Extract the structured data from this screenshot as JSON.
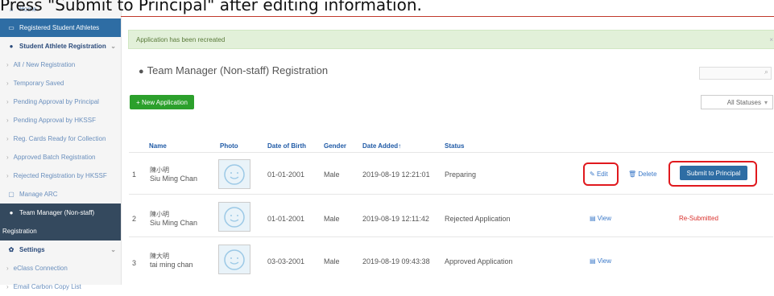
{
  "overlay_text": "Press \"Submit to Principal\" after editing information.",
  "sidebar": {
    "items": [
      {
        "icon": "home-icon",
        "label": "Home"
      },
      {
        "icon": "id-card-icon",
        "label": "Registered Student Athletes"
      },
      {
        "icon": "user-icon",
        "label": "Student Athlete Registration"
      },
      {
        "label": "All / New Registration"
      },
      {
        "label": "Temporary Saved"
      },
      {
        "label": "Pending Approval by Principal"
      },
      {
        "label": "Pending Approval by HKSSF"
      },
      {
        "label": "Reg. Cards Ready for Collection"
      },
      {
        "label": "Approved Batch Registration"
      },
      {
        "label": "Rejected Registration by HKSSF"
      },
      {
        "icon": "card-icon",
        "label": "Manage ARC"
      },
      {
        "icon": "user-icon",
        "label": "Team Manager (Non-staff)"
      },
      {
        "label": "Registration"
      },
      {
        "icon": "gear-icon",
        "label": "Settings"
      },
      {
        "label": "eClass Connection"
      },
      {
        "label": "Email Carbon Copy List"
      }
    ]
  },
  "alert": {
    "message": "Application has been recreated",
    "close": "×"
  },
  "page_title": "Team Manager (Non-staff) Registration",
  "new_application_label": "+ New Application",
  "status_filter": "All Statuses",
  "table": {
    "headers": [
      "Name",
      "Photo",
      "Date of Birth",
      "Gender",
      "Date Added↑",
      "Status"
    ],
    "rows": [
      {
        "num": "1",
        "name_cn": "陳小明",
        "name_en": "Siu Ming Chan",
        "dob": "01-01-2001",
        "gender": "Male",
        "added": "2019-08-19 12:21:01",
        "status": "Preparing",
        "action1": "Edit",
        "action2": "Delete",
        "action3": "Submit to Principal"
      },
      {
        "num": "2",
        "name_cn": "陳小明",
        "name_en": "Siu Ming Chan",
        "dob": "01-01-2001",
        "gender": "Male",
        "added": "2019-08-19 12:11:42",
        "status": "Rejected Application",
        "action1": "View",
        "action3": "Re-Submitted"
      },
      {
        "num": "3",
        "name_cn": "陳大明",
        "name_en": "tai ming chan",
        "dob": "03-03-2001",
        "gender": "Male",
        "added": "2019-08-19 09:43:38",
        "status": "Approved Application",
        "action1": "View"
      }
    ]
  },
  "colors": {
    "accent": "#2e6da4",
    "success": "#2ca02c",
    "highlight": "#e0191e"
  }
}
